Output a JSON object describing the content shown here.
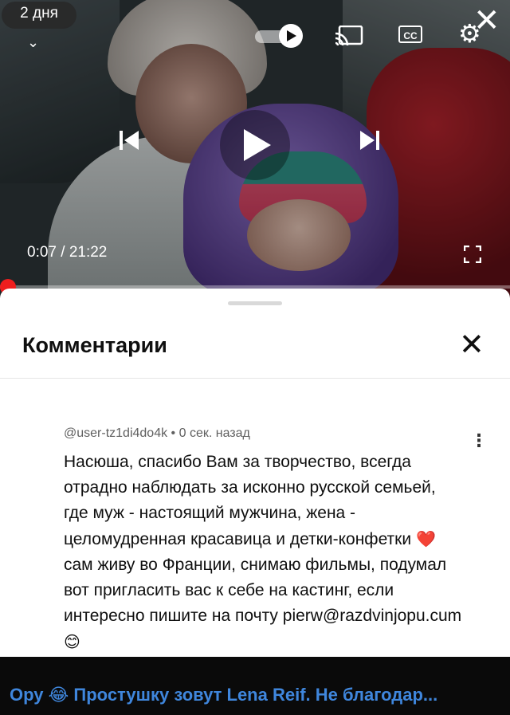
{
  "video": {
    "posted_ago": "2 дня",
    "current_time": "0:07",
    "duration": "21:22",
    "separator": "/",
    "progress_fraction": 0.0055,
    "icons": {
      "collapse": "chevron-down-icon",
      "close": "close-icon",
      "autoplay": "autoplay-toggle-icon",
      "cast": "cast-icon",
      "captions": "captions-icon",
      "settings": "gear-icon",
      "previous": "skip-previous-icon",
      "play": "play-icon",
      "next": "skip-next-icon",
      "fullscreen": "fullscreen-icon"
    },
    "cc_label": "CC"
  },
  "comments": {
    "title": "Комментарии",
    "items": [
      {
        "author": "@user-tz1di4do4k",
        "time": "0 сек. назад",
        "text_part1": "Насюша, спасибо Вам за творчество, всегда отрадно наблюдать за исконно русской семьей, где муж - настоящий мужчина, жена - целомудренная красавица и детки-конфетки",
        "emoji1": "❤️",
        "text_part2": "сам живу во Франции, снимаю фильмы, подумал вот пригласить вас к себе на кастинг, если интересно пишите на почту pierw@razdvinjopu.cum",
        "emoji2": "😊"
      }
    ]
  },
  "caption": {
    "text": "Ору 😂 Простушку зовут Lena Reif. Не благодар..."
  },
  "colors": {
    "accent_red": "#ee1e1e",
    "caption_blue": "#3f86dc"
  }
}
